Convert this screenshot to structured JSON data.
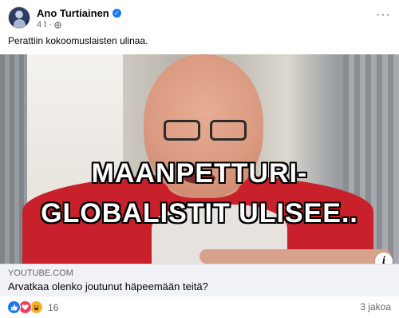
{
  "post": {
    "author": "Ano Turtiainen",
    "time": "4 t",
    "caption": "Perattiin kokoomuslaisten ulinaa.",
    "menu_label": "···",
    "video": {
      "overlay_line1": "MAANPETTURI-",
      "overlay_line2": "GLOBALISTIT ULISEE..",
      "info_label": "i"
    },
    "link": {
      "domain": "YOUTUBE.COM",
      "title": "Arvatkaa olenko joutunut häpeemään teitä?"
    },
    "reactions": {
      "types": [
        "like",
        "love",
        "haha"
      ],
      "count": "16"
    },
    "shares": "3 jakoa"
  },
  "colors": {
    "like": "#1877f2",
    "love": "#f33e58",
    "haha": "#f7b125",
    "verified": "#1877f2",
    "link_card_bg": "#f0f2f5"
  }
}
